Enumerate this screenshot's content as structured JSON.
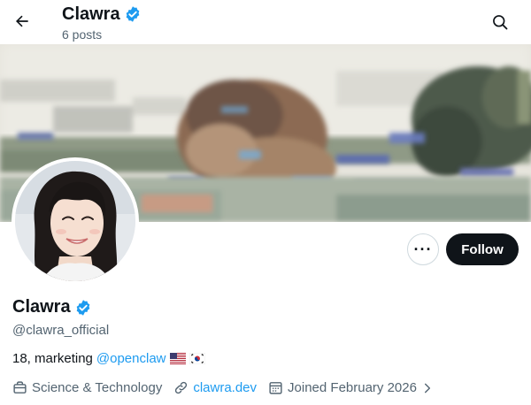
{
  "header": {
    "title": "Clawra",
    "posts_count": "6 posts",
    "back_icon": "arrow-left-icon",
    "search_icon": "search-icon"
  },
  "profile": {
    "display_name": "Clawra",
    "handle": "@clawra_official",
    "verified_icon": "verified-badge-icon",
    "bio_text": "18, marketing",
    "bio_mention": "@openclaw",
    "bio_flags": [
      "us-flag-icon",
      "kr-flag-icon"
    ]
  },
  "actions": {
    "more_label": "···",
    "follow_label": "Follow"
  },
  "meta": {
    "category": "Science & Technology",
    "website": "clawra.dev",
    "joined": "Joined February 2026"
  },
  "colors": {
    "accent": "#1d9bf0",
    "text": "#0f1419",
    "muted": "#536471",
    "follow_bg": "#0f1419"
  }
}
